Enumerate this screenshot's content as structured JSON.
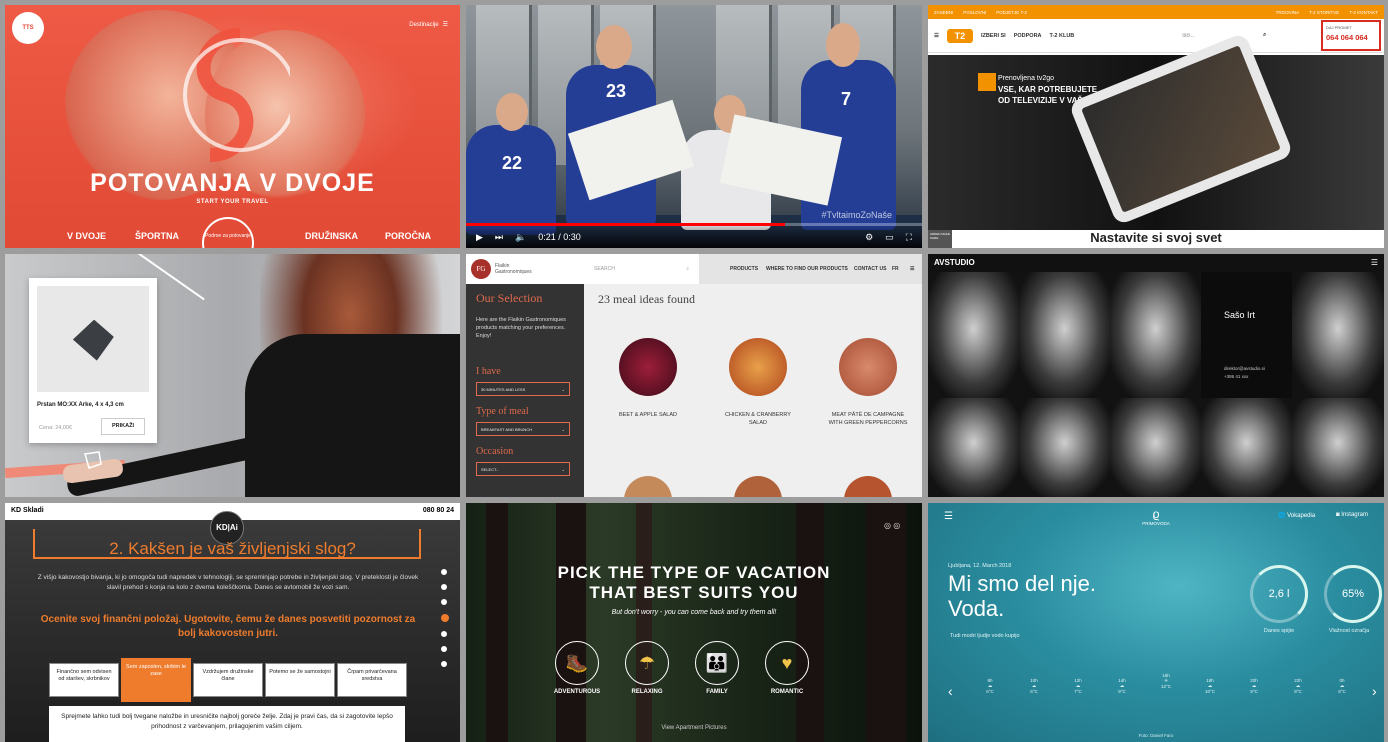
{
  "tile1": {
    "menu_label": "Destinacije",
    "title": "POTOVANJA V DVOJE",
    "subtitle": "START YOUR TRAVEL",
    "nav": [
      "V DVOJE",
      "ŠPORTNA",
      "DRUŽINSKA",
      "POROČNA"
    ],
    "center_label": "Podroe za potovanje",
    "accent": "#e14a35"
  },
  "tile2": {
    "jersey_numbers": [
      "23",
      "22",
      "7"
    ],
    "time": "0:21 / 0:30",
    "hashtag": "#TvltaimoZoNaše",
    "progress_pct": 70
  },
  "tile3": {
    "topbar": [
      "ZASEBNI",
      "POSLOVNI",
      "PODJETJE T-2",
      "TRGOVINA",
      "T-2 STORITVE",
      "T-2 KONTAKT"
    ],
    "logo": "T2",
    "nav": [
      "IZBERI SI",
      "PODPORA",
      "T-2 KLUB"
    ],
    "search_placeholder": "Išči...",
    "phone_label": "DAJ PROMET",
    "phone": "064 064 064",
    "hero_line1": "Prenovljena tv2go",
    "hero_line2": "VSE, KAR POTREBUJETE",
    "hero_line3": "OD TELEVIZIJE V VAŠEM ŽEPU",
    "bottom_heading": "Nastavite si svoj svet",
    "side_text": "ADDED MAKE SURE",
    "accent": "#f29200"
  },
  "tile4": {
    "product_name": "Prstan MO:XX Arke, 4 x 4,3 cm",
    "price": "Cena: 24,00€",
    "buy_label": "PRIKAŽI"
  },
  "tile5": {
    "brand_line1": "Flaikin",
    "brand_line2": "Gastronomiques",
    "search_placeholder": "SEARCH",
    "nav": [
      "PRODUCTS",
      "WHERE TO FIND OUR PRODUCTS",
      "CONTACT US",
      "FR"
    ],
    "selection_title": "Our Selection",
    "selection_desc": "Here are the Flaikin Gastronomiques products matching your preferences. Enjoy!",
    "filters": [
      {
        "label": "I have",
        "value": "30 MINUTES AND LESS"
      },
      {
        "label": "Type of meal",
        "value": "BREAKFAST AND BRUNCH"
      },
      {
        "label": "Occasion",
        "value": "SELECT..."
      }
    ],
    "found": "23 meal ideas found",
    "meals": [
      "BEET & APPLE SALAD",
      "CHICKEN & CRANBERRY SALAD",
      "MEAT PÂTÉ DE CAMPAGNE WITH GREEN PEPPERCORNS"
    ]
  },
  "tile6": {
    "brand": "AVSTUDIO",
    "featured_name": "Sašo Irt",
    "featured_role": "direktor@avstudio.si",
    "featured_phone": "+386 41 xxx"
  },
  "tile7": {
    "brand": "KD Skladi",
    "phone": "080 80 24",
    "badge": "KD|Ai",
    "question": "2. Kakšen je vaš življenjski slog?",
    "paragraph": "Z višjo kakovostjo bivanja, ki jo omogoča tudi napredek v tehnologiji, se spreminjajo potrebe in življenjski slog. V preteklosti je človek slavil prehod s konja na kolo z dvema koleščkoma. Danes se avtomobil že vozi sam.",
    "callout": "Ocenite svoj finančni položaj. Ugotovite, čemu že danes posvetiti pozornost za bolj kakovosten jutri.",
    "options": [
      "Finančno sem odvisen od staršev, skrbnikov",
      "Sem zaposlen, skrbim le zase",
      "Vzdržujem družinske člane",
      "Potemo se že samostojni",
      "Črpam privarčevana sredstva"
    ],
    "answer": "Sprejmete lahko tudi bolj tvegane naložbe in uresničite najbolj goreče želje. Zdaj je pravi čas, da si zagotovite lepšo prihodnost z varčevanjem, prilagojenim vašim ciljem.",
    "accent": "#ef7c2d"
  },
  "tile8": {
    "title_line1": "PICK THE TYPE OF VACATION",
    "title_line2": "THAT BEST SUITS YOU",
    "subtitle": "But don't worry - you can come back and try them all!",
    "types": [
      {
        "label": "ADVENTUROUS",
        "icon": "hiker-icon"
      },
      {
        "label": "RELAXING",
        "icon": "relax-icon"
      },
      {
        "label": "FAMILY",
        "icon": "family-icon"
      },
      {
        "label": "ROMANTIC",
        "icon": "romantic-icon"
      }
    ],
    "footer": "View Apartment Pictures"
  },
  "tile9": {
    "brand": "PRIMOVODA",
    "nav": [
      "Vokapedia",
      "Instagram"
    ],
    "date": "Ljubljana, 12. March 2018",
    "headline_line1": "Mi smo del nje.",
    "headline_line2": "Voda.",
    "link": "Tudi modri ljudje vodo kupijo",
    "gauges": [
      {
        "value": "2,6 l",
        "label": "Danes spijte"
      },
      {
        "value": "65%",
        "label": "Vlažnost ozračja"
      }
    ],
    "temps": [
      "6°C",
      "6°C",
      "7°C",
      "9°C",
      "12°C",
      "10°C",
      "9°C",
      "8°C",
      "8°C"
    ],
    "hours": [
      "8h",
      "10h",
      "12h",
      "14h",
      "16h",
      "18h",
      "20h",
      "22h",
      "0h"
    ],
    "footer": "Foto: Daniel Faro"
  }
}
